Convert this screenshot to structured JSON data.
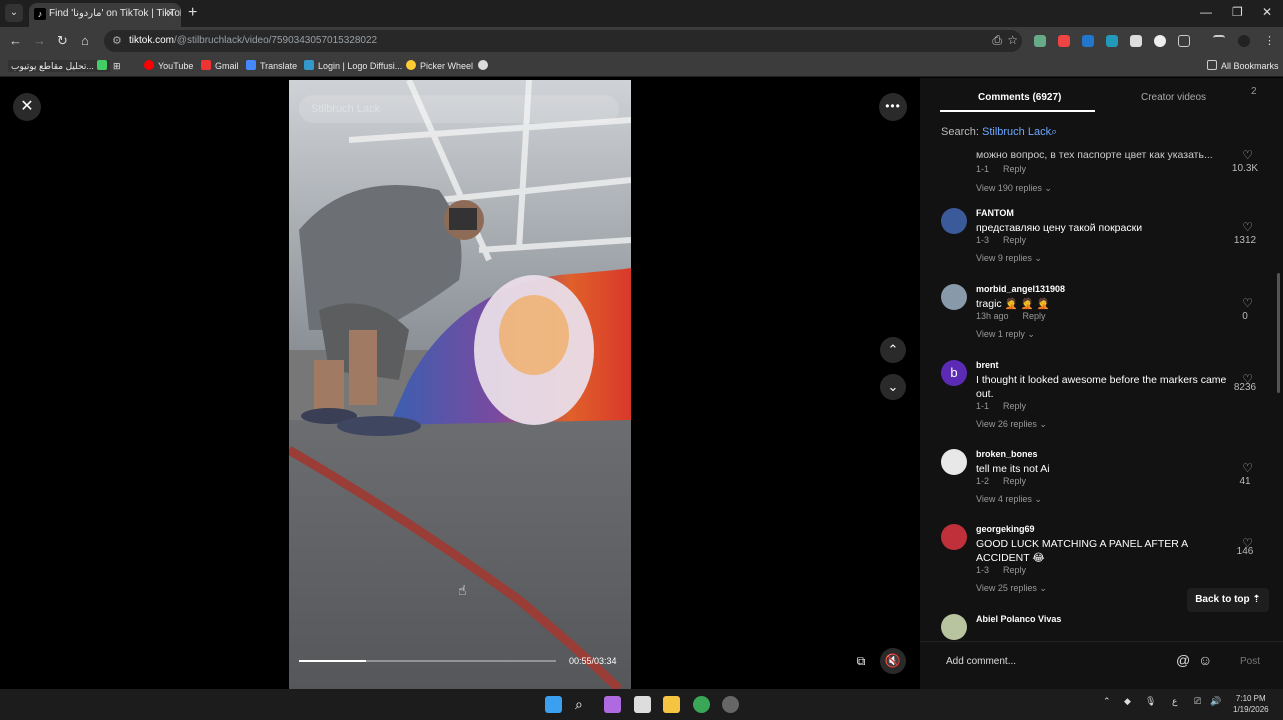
{
  "browser": {
    "tab_title": "Find 'ماردونا' on TikTok | TikTok",
    "url_host": "tiktok.com",
    "url_path": "/@stilbruchlack/video/7590343057015328022",
    "bookmarks": [
      "تحليل مقاطع يوتيوب...",
      "YouTube",
      "Gmail",
      "Translate",
      "Login | Logo Diffusi...",
      "Picker Wheel"
    ],
    "all_bookmarks": "All Bookmarks"
  },
  "video": {
    "search_placeholder": "Stilbruch Lack",
    "time": "00:55/03:34",
    "progress": 0.26
  },
  "panel": {
    "tab_comments": "Comments (6927)",
    "tab_creator": "Creator videos",
    "search_label": "Search:",
    "search_term": "Stilbruch Lack",
    "truncated_comment": "можно вопрос, в тех паспорте цвет как указать...",
    "truncated_meta": "1-1",
    "truncated_reply": "Reply",
    "truncated_likes": "10.3K",
    "truncated_replies": "View 190 replies",
    "comments": [
      {
        "user": "FANTOM",
        "text": "представляю цену такой покраски",
        "date": "1-3",
        "reply": "Reply",
        "likes": "1312",
        "replies": "View 9 replies",
        "color": "#3b5a9a"
      },
      {
        "user": "morbid_angel131908",
        "text": "tragic 🤦 🤦 🤦",
        "date": "13h ago",
        "reply": "Reply",
        "likes": "0",
        "replies": "View 1 reply",
        "color": "#8899aa"
      },
      {
        "user": "brent",
        "text": "I thought it looked awesome before the markers came out.",
        "date": "1-1",
        "reply": "Reply",
        "likes": "8236",
        "replies": "View 26 replies",
        "color": "#5b2bb5",
        "initial": "b"
      },
      {
        "user": "broken_bones",
        "text": "tell me its not Ai",
        "date": "1-2",
        "reply": "Reply",
        "likes": "41",
        "replies": "View 4 replies",
        "color": "#e8e8e8"
      },
      {
        "user": "georgeking69",
        "text": "GOOD LUCK MATCHING A PANEL AFTER A ACCIDENT 😂",
        "date": "1-3",
        "reply": "Reply",
        "likes": "146",
        "replies": "View 25 replies",
        "color": "#c0303a"
      }
    ],
    "last_user": "Abiel Polanco Vivas",
    "back_to_top": "Back to top",
    "add_comment": "Add comment...",
    "post": "Post"
  },
  "taskbar": {
    "time": "7:10 PM",
    "date": "1/19/2026",
    "lang": "ع"
  }
}
